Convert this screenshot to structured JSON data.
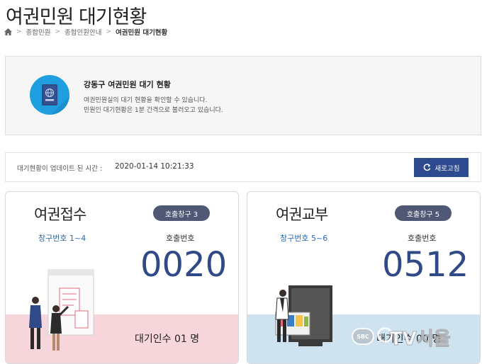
{
  "header": {
    "title": "여권민원 대기현황",
    "breadcrumb": [
      "종합민원",
      "종합민원안내",
      "여권민원 대기현황"
    ]
  },
  "info": {
    "title": "강동구 여권민원 대기 현황",
    "line1": "여권민원실의 대기 현황을 확인할 수 있습니다.",
    "line2": "민원인 대기현황은 1분 간격으로 불러오고 있습니다.",
    "passport_label": "PASSPORT",
    "icon": "passport-icon"
  },
  "update": {
    "label": "대기현황이 업데이트 된 시간 :",
    "time": "2020-01-14 10:21:33",
    "refresh_label": "새로고침"
  },
  "cards": [
    {
      "title": "여권접수",
      "badge": "호출창구 3",
      "window_range": "창구번호 1~4",
      "call_label": "호출번호",
      "number": "0020",
      "waiting": "대기인수 01 명",
      "bottom_color": "#f6d6db"
    },
    {
      "title": "여권교부",
      "badge": "호출창구 5",
      "window_range": "창구번호 5~6",
      "call_label": "호출번호",
      "number": "0512",
      "waiting": "대기인수 00 명",
      "bottom_color": "#cfe2f0"
    }
  ],
  "watermark": {
    "logo": "SBC",
    "text": "TV서울"
  },
  "colors": {
    "accent": "#2d4a8f",
    "number": "#2f4a87",
    "badge": "#4f5874",
    "window_text": "#2d6aa8",
    "icon_bg": "#1f9ee0"
  }
}
